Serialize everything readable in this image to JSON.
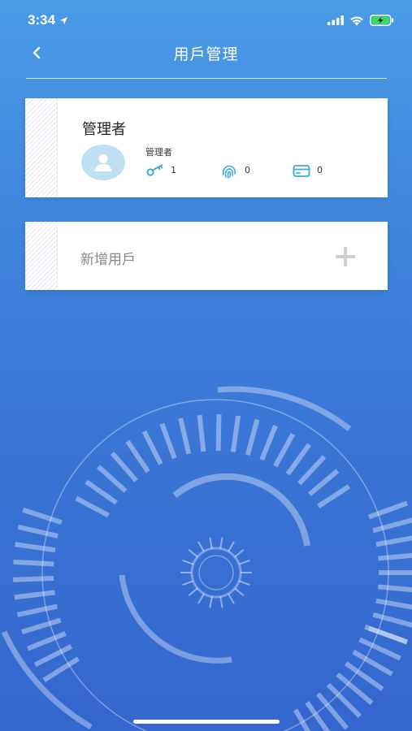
{
  "status_bar": {
    "time": "3:34",
    "location_icon": "location-arrow-icon",
    "signal_icon": "cellular-signal-icon",
    "wifi_icon": "wifi-icon",
    "battery_icon": "battery-charging-icon"
  },
  "nav": {
    "title": "用戶管理",
    "back_icon": "chevron-left-icon"
  },
  "users": [
    {
      "name": "管理者",
      "role": "管理者",
      "key_count": "1",
      "fingerprint_count": "0",
      "card_count": "0"
    }
  ],
  "add_user": {
    "label": "新增用戶",
    "icon": "plus-icon"
  },
  "colors": {
    "background_top": "#4a9be6",
    "background_bottom": "#3467cf",
    "icon_blue": "#3fa8e0",
    "avatar_bg": "#bfe0f2"
  }
}
